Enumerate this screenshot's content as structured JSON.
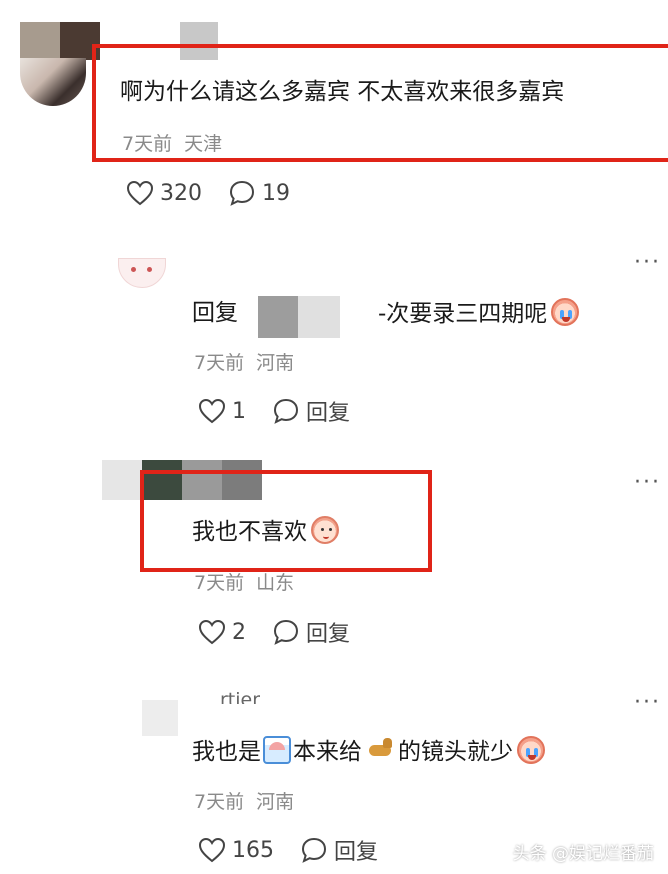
{
  "comments": [
    {
      "text": "啊为什么请这么多嘉宾 不太喜欢来很多嘉宾",
      "time": "7天前",
      "location": "天津",
      "likes": "320",
      "replies": "19"
    }
  ],
  "replies": [
    {
      "prefix": "回复",
      "text": "-次要录三四期呢",
      "time": "7天前",
      "location": "河南",
      "likes": "1",
      "reply_label": "回复"
    },
    {
      "text": "我也不喜欢",
      "time": "7天前",
      "location": "山东",
      "likes": "2",
      "reply_label": "回复"
    },
    {
      "username_fragment": "rtier",
      "text_a": "我也是",
      "text_b": "本来给",
      "text_c": "的镜头就少",
      "time": "7天前",
      "location": "河南",
      "likes": "165",
      "reply_label": "回复"
    }
  ],
  "watermark": "头条 @娱记烂番茄",
  "icons": {
    "like": "heart-icon",
    "comment": "comment-bubble-icon",
    "more": "more-dots-icon",
    "emoji_cry": "crying-face-emoji",
    "emoji_sweat": "sweating-face-emoji",
    "emoji_pile": "dogpile-emoji",
    "emoji_dog": "dog-emoji"
  },
  "colors": {
    "highlight_box": "#e02418",
    "meta_text": "#8a8a8a"
  }
}
